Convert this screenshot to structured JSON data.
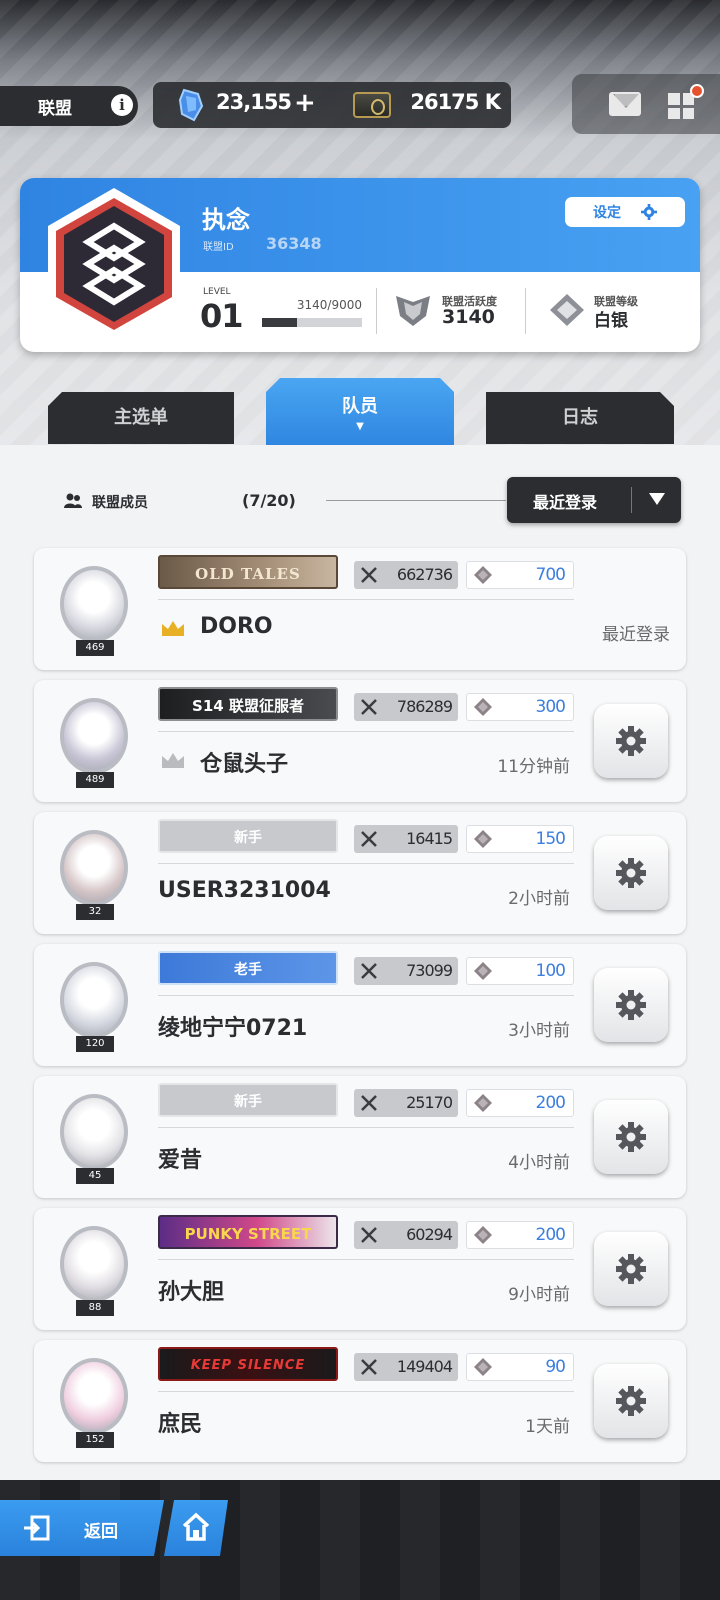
{
  "topbar": {
    "section_label": "联盟",
    "gems": "23,155",
    "tickets": "26175 K",
    "icons": [
      "info-icon",
      "gem-icon",
      "plus-icon",
      "ticket-icon",
      "mail-icon",
      "menu-grid-icon"
    ]
  },
  "union": {
    "name": "执念",
    "id_label": "联盟ID",
    "id_value": "36348",
    "settings_label": "设定",
    "level_label": "LEVEL",
    "level_value": "01",
    "exp_text": "3140/9000",
    "exp_fraction": 0.35,
    "activity_label": "联盟活跃度",
    "activity_value": "3140",
    "rank_label": "联盟等级",
    "rank_value": "白银"
  },
  "tabs": [
    {
      "label": "主选单",
      "active": false
    },
    {
      "label": "队员",
      "active": true
    },
    {
      "label": "日志",
      "active": false
    }
  ],
  "members_header": {
    "title": "联盟成员",
    "count": "(7/20)",
    "sort_label": "最近登录"
  },
  "members": [
    {
      "name": "DORO",
      "level": "469",
      "banner": "OLD TALES",
      "power": "662736",
      "contribution": "700",
      "last_login": "最近登录",
      "is_leader": true
    },
    {
      "name": "仓鼠头子",
      "level": "489",
      "banner": "S14 联盟征服者",
      "power": "786289",
      "contribution": "300",
      "last_login": "11分钟前",
      "is_leader": false
    },
    {
      "name": "USER3231004",
      "level": "32",
      "banner": "新手",
      "power": "16415",
      "contribution": "150",
      "last_login": "2小时前",
      "is_leader": false
    },
    {
      "name": "绫地宁宁0721",
      "level": "120",
      "banner": "老手",
      "power": "73099",
      "contribution": "100",
      "last_login": "3小时前",
      "is_leader": false
    },
    {
      "name": "爱昔",
      "level": "45",
      "banner": "新手",
      "power": "25170",
      "contribution": "200",
      "last_login": "4小时前",
      "is_leader": false
    },
    {
      "name": "孙大胆",
      "level": "88",
      "banner": "PUNKY STREET",
      "power": "60294",
      "contribution": "200",
      "last_login": "9小时前",
      "is_leader": false
    },
    {
      "name": "庶民",
      "level": "152",
      "banner": "KEEP SILENCE",
      "power": "149404",
      "contribution": "90",
      "last_login": "1天前",
      "is_leader": false
    }
  ],
  "bottom": {
    "back_label": "返回"
  },
  "colors": {
    "accent_blue": "#2f84e2",
    "dark": "#2b2d31",
    "notification": "#e8512e"
  }
}
